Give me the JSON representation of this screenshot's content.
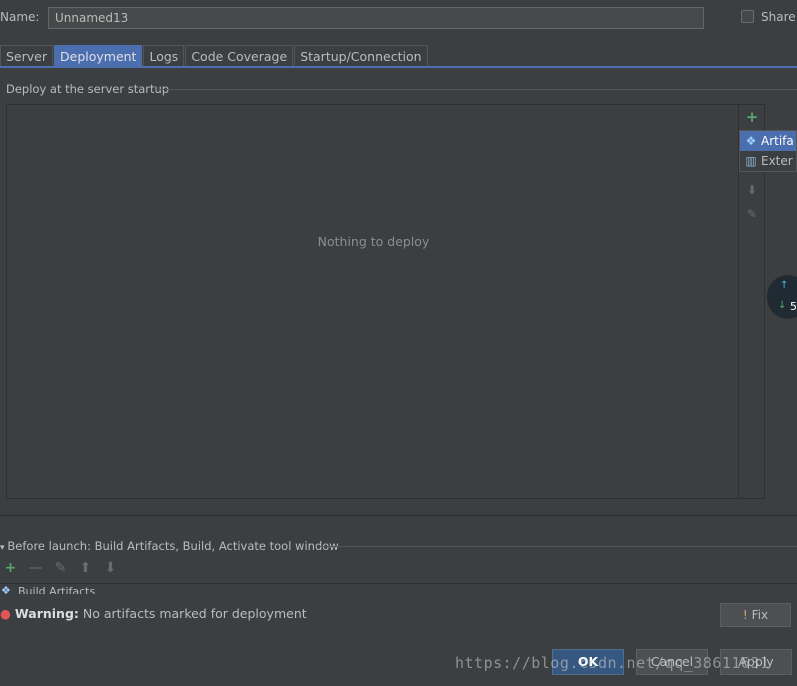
{
  "header": {
    "name_label": "Name:",
    "name_value": "Unnamed13",
    "share_label": "Share"
  },
  "tabs": [
    {
      "label": "Server",
      "active": false
    },
    {
      "label": "Deployment",
      "active": true
    },
    {
      "label": "Logs",
      "active": false
    },
    {
      "label": "Code Coverage",
      "active": false
    },
    {
      "label": "Startup/Connection",
      "active": false
    }
  ],
  "deploy": {
    "section_title": "Deploy at the server startup",
    "empty_text": "Nothing to deploy",
    "add_icon": "plus-icon",
    "popup": [
      "Artifa",
      "Exter"
    ]
  },
  "float_widget": {
    "count": "5"
  },
  "before_launch": {
    "title": "Before launch: Build Artifacts, Build, Activate tool window",
    "item": "Build Artifacts"
  },
  "warning": {
    "bold": "Warning:",
    "text": " No artifacts marked for deployment",
    "fix_label": "Fix"
  },
  "buttons": {
    "ok": "OK",
    "cancel": "Cancel",
    "apply": "Apply"
  },
  "watermark": "https://blog.csdn.net/qq_38611631",
  "colors": {
    "accent": "#4b6eaf",
    "add": "#59a869",
    "warning": "#e05555"
  }
}
